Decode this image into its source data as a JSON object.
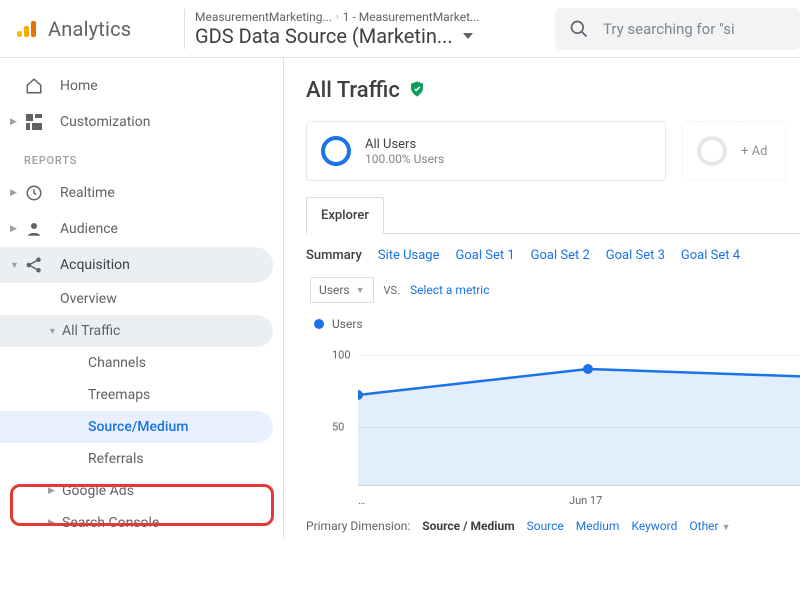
{
  "header": {
    "product": "Analytics",
    "breadcrumb_account": "MeasurementMarketing...",
    "breadcrumb_property": "1 - MeasurementMarket...",
    "property_selector": "GDS Data Source (Marketin...",
    "search_placeholder": "Try searching for \"si"
  },
  "sidebar": {
    "home": "Home",
    "customization": "Customization",
    "reports_label": "REPORTS",
    "realtime": "Realtime",
    "audience": "Audience",
    "acquisition": "Acquisition",
    "overview": "Overview",
    "all_traffic": "All Traffic",
    "channels": "Channels",
    "treemaps": "Treemaps",
    "source_medium": "Source/Medium",
    "referrals": "Referrals",
    "google_ads": "Google Ads",
    "search_console": "Search Console"
  },
  "content": {
    "title": "All Traffic",
    "segment_all_users": "All Users",
    "segment_all_users_sub": "100.00% Users",
    "segment_add": "+ Ad",
    "tab_explorer": "Explorer",
    "subtabs": {
      "summary": "Summary",
      "site_usage": "Site Usage",
      "goal1": "Goal Set 1",
      "goal2": "Goal Set 2",
      "goal3": "Goal Set 3",
      "goal4": "Goal Set 4"
    },
    "metric_primary": "Users",
    "metric_vs": "VS.",
    "metric_select": "Select a metric",
    "legend_users": "Users",
    "prim_dim_label": "Primary Dimension:",
    "dims": {
      "source_medium": "Source / Medium",
      "source": "Source",
      "medium": "Medium",
      "keyword": "Keyword",
      "other": "Other"
    }
  },
  "chart_data": {
    "type": "line",
    "title": "",
    "xlabel": "",
    "ylabel": "",
    "ylim": [
      0,
      120
    ],
    "y_ticks": [
      50,
      100
    ],
    "categories": [
      "…",
      "Jun 17",
      ""
    ],
    "series": [
      {
        "name": "Users",
        "values": [
          73,
          92,
          87
        ]
      }
    ]
  }
}
